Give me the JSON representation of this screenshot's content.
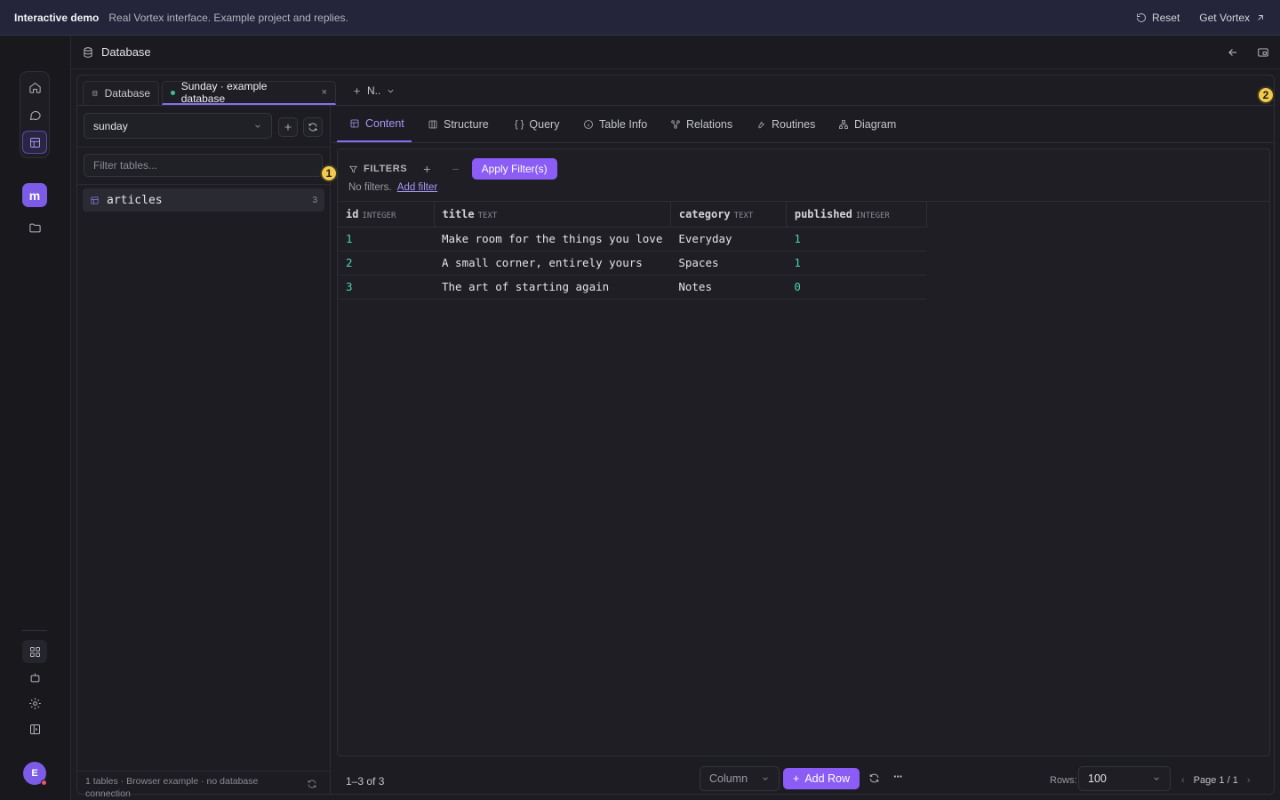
{
  "banner": {
    "title": "Interactive demo",
    "subtitle": "Real Vortex interface. Example project and replies.",
    "reset_label": "Reset",
    "get_label": "Get Vortex"
  },
  "rail": {
    "avatar_letter": "m",
    "user_initial": "E"
  },
  "header": {
    "title": "Database"
  },
  "tabs": [
    {
      "label": "Database"
    },
    {
      "label": "Sunday · example database",
      "close": "×"
    }
  ],
  "new_tab": {
    "label": "N.."
  },
  "badges": [
    "1",
    "2"
  ],
  "sidebar": {
    "db_selected": "sunday",
    "filter_placeholder": "Filter tables...",
    "tables": [
      {
        "name": "articles",
        "count": "3"
      }
    ],
    "footer": "1 tables · Browser example · no database connection"
  },
  "subtabs": [
    "Content",
    "Structure",
    "Query",
    "Table Info",
    "Relations",
    "Routines",
    "Diagram"
  ],
  "filters": {
    "label": "FILTERS",
    "plus": "+",
    "minus": "−",
    "apply_label": "Apply Filter(s)",
    "none_text": "No filters.",
    "add_link": "Add filter"
  },
  "grid": {
    "columns": [
      {
        "name": "id",
        "type": "INTEGER"
      },
      {
        "name": "title",
        "type": "TEXT"
      },
      {
        "name": "category",
        "type": "TEXT"
      },
      {
        "name": "published",
        "type": "INTEGER"
      }
    ],
    "rows": [
      [
        "1",
        "Make room for the things you love",
        "Everyday",
        "1"
      ],
      [
        "2",
        "A small corner, entirely yours",
        "Spaces",
        "1"
      ],
      [
        "3",
        "The art of starting again",
        "Notes",
        "0"
      ]
    ]
  },
  "bottom": {
    "row_range": "1–3 of 3",
    "column_select": "Column",
    "add_row_label": "Add Row",
    "more": "···",
    "rows_label": "Rows:",
    "rows_value": "100",
    "page_label": "Page 1 / 1"
  },
  "colors": {
    "accent": "#8b5cf6",
    "badge": "#f2c94c",
    "number": "#4fd1b0"
  }
}
